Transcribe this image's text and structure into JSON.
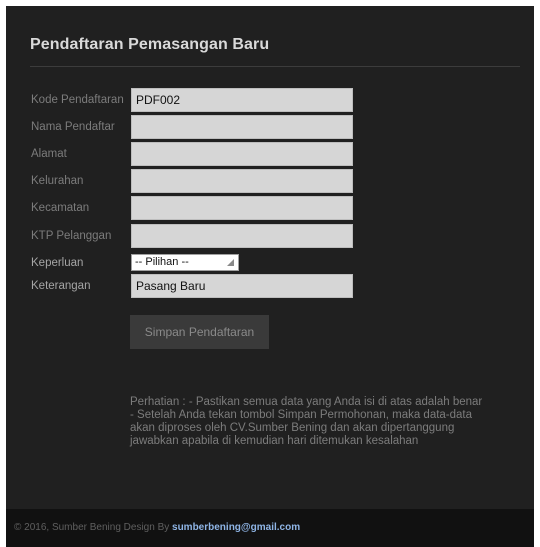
{
  "form": {
    "title": "Pendaftaran Pemasangan Baru",
    "fields": [
      {
        "label": "Kode Pendaftaran",
        "value": "PDF002"
      },
      {
        "label": "Nama Pendaftar",
        "value": ""
      },
      {
        "label": "Alamat",
        "value": ""
      },
      {
        "label": "Kelurahan",
        "value": ""
      },
      {
        "label": "Kecamatan",
        "value": ""
      },
      {
        "label": "KTP Pelanggan",
        "value": ""
      }
    ],
    "keperluan": {
      "label": "Keperluan",
      "selected": "-- Pilihan --"
    },
    "keterangan": {
      "label": "Keterangan",
      "value": "Pasang Baru"
    },
    "submit_label": "Simpan Pendaftaran",
    "note": "Perhatian : - Pastikan semua data yang Anda isi di atas adalah benar - Setelah Anda tekan tombol Simpan Permohonan, maka data-data akan diproses oleh CV.Sumber Bening dan akan dipertanggung jawabkan apabila di kemudian hari ditemukan kesalahan"
  },
  "footer": {
    "text": "© 2016, Sumber Bening Design By",
    "email": "sumberbening@gmail.com"
  }
}
